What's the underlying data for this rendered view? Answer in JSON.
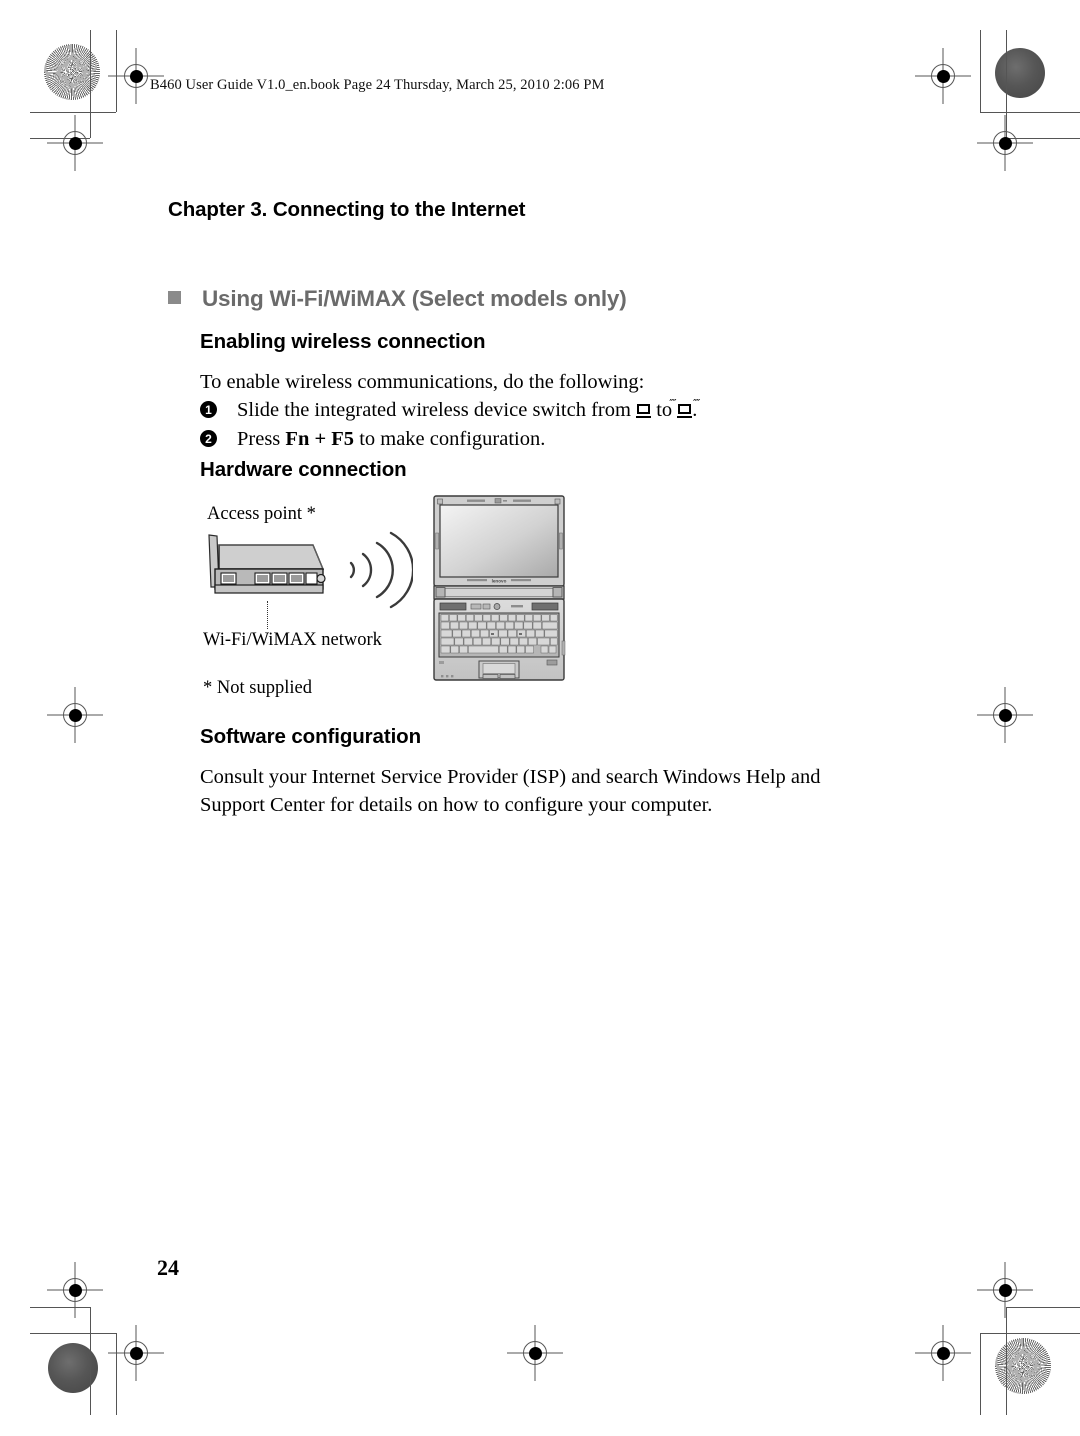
{
  "header": {
    "file_line": "B460 User Guide V1.0_en.book  Page 24  Thursday, March 25, 2010  2:06 PM"
  },
  "page": {
    "chapter_title": "Chapter 3. Connecting to the Internet",
    "page_number": "24"
  },
  "section": {
    "title": "Using Wi-Fi/WiMAX (Select models only)",
    "bullet_color": "#8a8a8a",
    "title_color": "#6b6b6b"
  },
  "enabling": {
    "heading": "Enabling wireless connection",
    "intro": "To enable wireless communications, do the following:",
    "steps": [
      {
        "number": "1",
        "text_before": "Slide the integrated wireless device switch from",
        "text_middle": "to",
        "text_after": "."
      },
      {
        "number": "2",
        "text_before": "Press",
        "keys": "Fn + F5",
        "text_after": "to make configuration."
      }
    ]
  },
  "hardware": {
    "heading": "Hardware connection",
    "labels": {
      "access_point": "Access point *",
      "network": "Wi-Fi/WiMAX network",
      "footnote": "* Not supplied"
    }
  },
  "software": {
    "heading": "Software configuration",
    "body_line1": "Consult your Internet Service Provider (ISP) and search Windows Help and",
    "body_line2": "Support Center for details on how to configure your computer."
  }
}
